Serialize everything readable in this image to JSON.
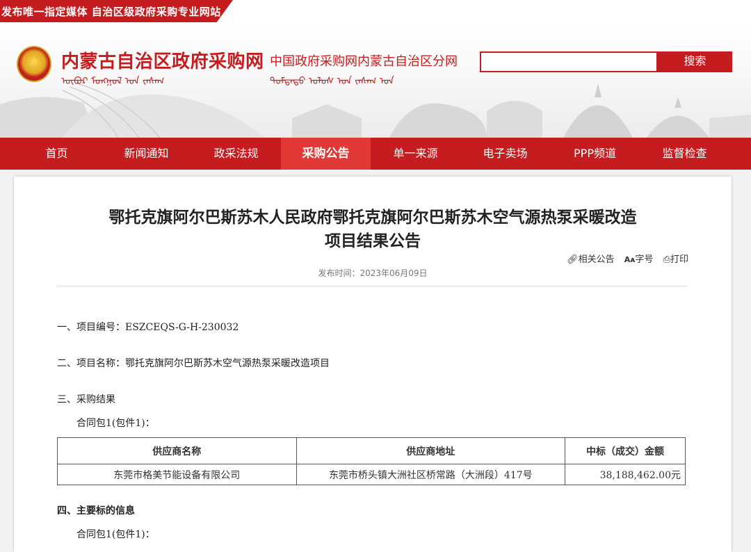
{
  "topbar": {
    "slogan": "发布唯一指定媒体  自治区级政府采购专业网站"
  },
  "header": {
    "site_title": "内蒙古自治区政府采购网",
    "subtitle": "中国政府采购网内蒙古自治区分网",
    "mongol_title": "ᠥᠪᠥᠷ ᠮᠣᠩᠭᠣᠯ ᠤᠨ ᠵᠠᠰᠠᠭ",
    "mongol_subtitle": "ᠳᠤᠮᠳᠠᠳᠤ ᠤᠯᠤᠰ ᠤᠨ ᠵᠠᠰᠠᠭ ᠤᠨ",
    "search_placeholder": "",
    "search_button": "搜索"
  },
  "nav": [
    {
      "label": "首页",
      "active": false
    },
    {
      "label": "新闻通知",
      "active": false
    },
    {
      "label": "政采法规",
      "active": false
    },
    {
      "label": "采购公告",
      "active": true
    },
    {
      "label": "单一来源",
      "active": false
    },
    {
      "label": "电子卖场",
      "active": false
    },
    {
      "label": "PPP频道",
      "active": false
    },
    {
      "label": "监督检查",
      "active": false
    }
  ],
  "article": {
    "title_line1": "鄂托克旗阿尔巴斯苏木人民政府鄂托克旗阿尔巴斯苏木空气源热泵采暖改造",
    "title_line2": "项目结果公告",
    "tools": {
      "related": "相关公告",
      "font": "字号",
      "print": "打印"
    },
    "date": "发布时间：2023年06月09日",
    "sections": {
      "s1": "一、项目编号：ESZCEQS-G-H-230032",
      "s2": "二、项目名称：鄂托克旗阿尔巴斯苏木空气源热泵采暖改造项目",
      "s3": "三、采购结果",
      "s3_pkg": "合同包1(包件1)：",
      "s4": "四、主要标的信息",
      "s4_pkg": "合同包1(包件1)："
    },
    "table": {
      "headers": [
        "供应商名称",
        "供应商地址",
        "中标（成交）金额"
      ],
      "rows": [
        [
          "东莞市格美节能设备有限公司",
          "东莞市桥头镇大洲社区桥常路（大洲段）417号",
          "38,188,462.00元"
        ]
      ]
    }
  },
  "colors": {
    "brand_red": "#c51d1f",
    "active_nav": "#e13a36"
  },
  "icons": {
    "related": "link-icon",
    "font": "font-size-icon",
    "print": "printer-icon"
  }
}
